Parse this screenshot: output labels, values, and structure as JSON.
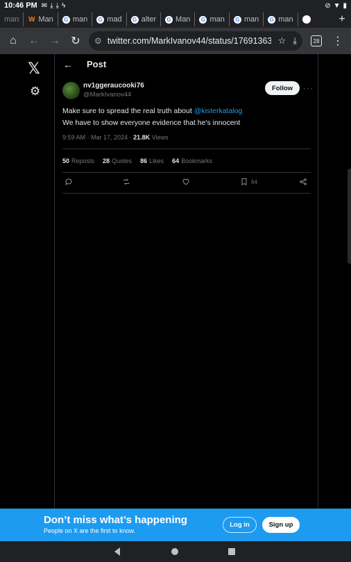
{
  "status_bar": {
    "time": "10:46 PM"
  },
  "tabs": [
    {
      "label": "man",
      "fav": "g"
    },
    {
      "label": "Man",
      "fav": "w"
    },
    {
      "label": "man",
      "fav": "g"
    },
    {
      "label": "mad",
      "fav": "g"
    },
    {
      "label": "alter",
      "fav": "g"
    },
    {
      "label": "Man",
      "fav": "g"
    },
    {
      "label": "man",
      "fav": "g"
    },
    {
      "label": "man",
      "fav": "g"
    },
    {
      "label": "man",
      "fav": "g"
    }
  ],
  "browser": {
    "url": "twitter.com/MarkIvanov44/status/17691363",
    "tab_count": "28"
  },
  "page": {
    "header_title": "Post"
  },
  "tweet": {
    "display_name": "nv1ggeraucooki76",
    "handle": "@MarkIvanov44",
    "follow_label": "Follow",
    "text_line1_prefix": "Make sure to spread the real truth about ",
    "mention": "@kisterkatalog",
    "text_line2": "We have to show everyone evidence that he's innocent",
    "time": "9:59 AM",
    "date": "Mar 17, 2024",
    "views_count": "21.8K",
    "views_label": "Views",
    "reposts_count": "50",
    "reposts_label": "Reposts",
    "quotes_count": "28",
    "quotes_label": "Quotes",
    "likes_count": "86",
    "likes_label": "Likes",
    "bookmarks_count": "64",
    "bookmarks_label": "Bookmarks",
    "bookmark_action_count": "64"
  },
  "banner": {
    "title": "Don’t miss what’s happening",
    "subtitle": "People on X are the first to know.",
    "login_label": "Log in",
    "signup_label": "Sign up"
  },
  "colors": {
    "accent": "#1d9bf0",
    "background": "#000000",
    "muted": "#71767b"
  }
}
